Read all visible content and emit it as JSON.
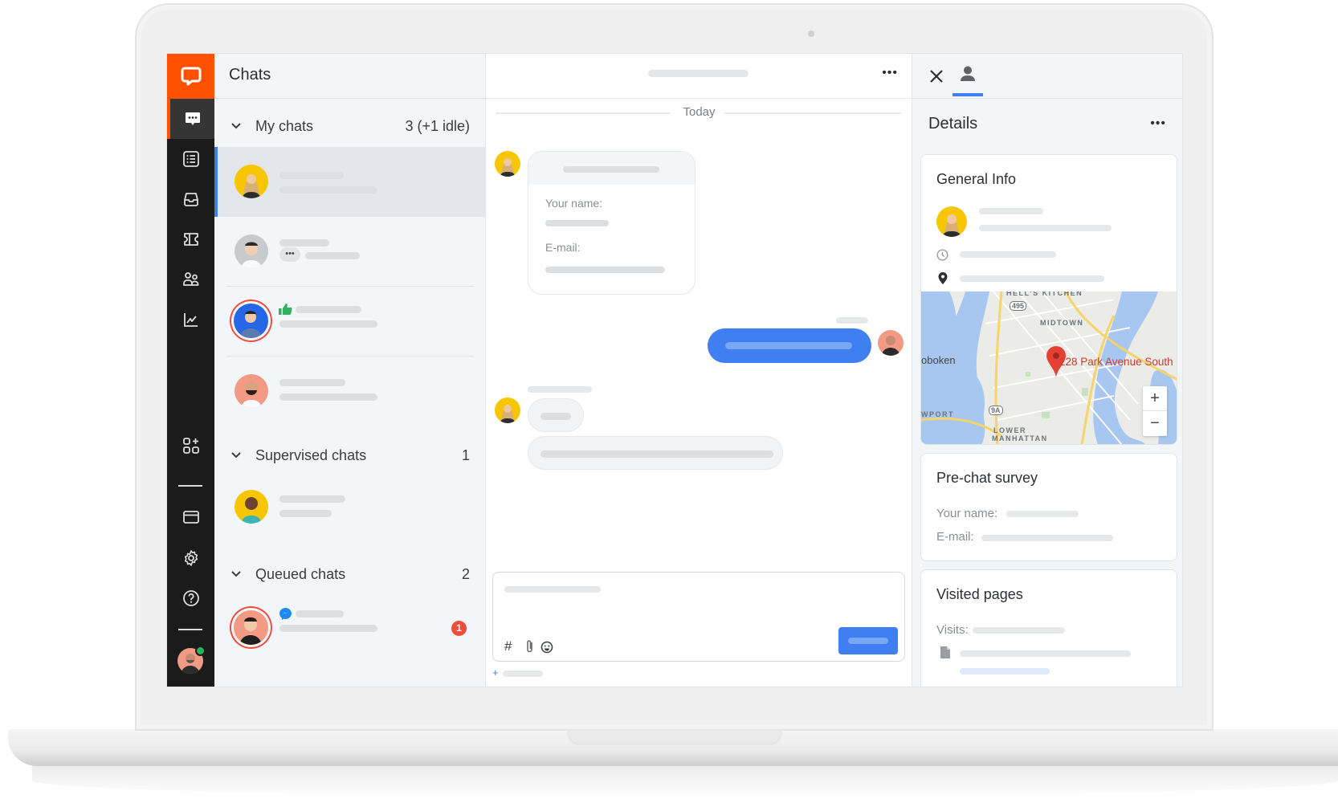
{
  "app": {
    "brand_color": "#ff5100",
    "accent_color": "#3f7ff1",
    "rail_background": "#1b1b1b"
  },
  "rail": {
    "items": [
      {
        "name": "chats",
        "icon": "chat-bubble-icon",
        "active": true
      },
      {
        "name": "archives",
        "icon": "list-icon",
        "active": false
      },
      {
        "name": "inbox",
        "icon": "inbox-tray-icon",
        "active": false
      },
      {
        "name": "tickets",
        "icon": "ticket-icon",
        "active": false
      },
      {
        "name": "customers",
        "icon": "people-icon",
        "active": false
      },
      {
        "name": "reports",
        "icon": "chart-line-icon",
        "active": false
      }
    ],
    "bottom_items": [
      {
        "name": "apps",
        "icon": "apps-add-icon"
      },
      {
        "name": "billing",
        "icon": "card-icon"
      },
      {
        "name": "settings",
        "icon": "gear-icon"
      },
      {
        "name": "help",
        "icon": "help-circle-icon"
      }
    ],
    "user_status": "online"
  },
  "chats_panel": {
    "title": "Chats",
    "sections": [
      {
        "label": "My chats",
        "count": "3 (+1 idle)"
      },
      {
        "label": "Supervised chats",
        "count": "1"
      },
      {
        "label": "Queued chats",
        "count": "2"
      }
    ],
    "queued_unread_badge": "1"
  },
  "chat_area": {
    "date_divider": "Today",
    "form_card": {
      "field_1": "Your name:",
      "field_2": "E-mail:"
    },
    "composer": {
      "tools": [
        "#",
        "📎",
        "☺"
      ]
    },
    "add_label": "+"
  },
  "details": {
    "title": "Details",
    "general_info": {
      "title": "General Info",
      "map_address": "228 Park Avenue South",
      "map_labels": [
        "HELL'S KITCHEN",
        "MIDTOWN",
        "oboken",
        "WPORT",
        "LOWER",
        "MANHATTAN",
        "495",
        "9A"
      ],
      "zoom_in": "+",
      "zoom_out": "−"
    },
    "pre_chat_survey": {
      "title": "Pre-chat survey",
      "name_label": "Your name:",
      "email_label": "E-mail:"
    },
    "visited_pages": {
      "title": "Visited pages",
      "visits_label": "Visits:"
    }
  }
}
